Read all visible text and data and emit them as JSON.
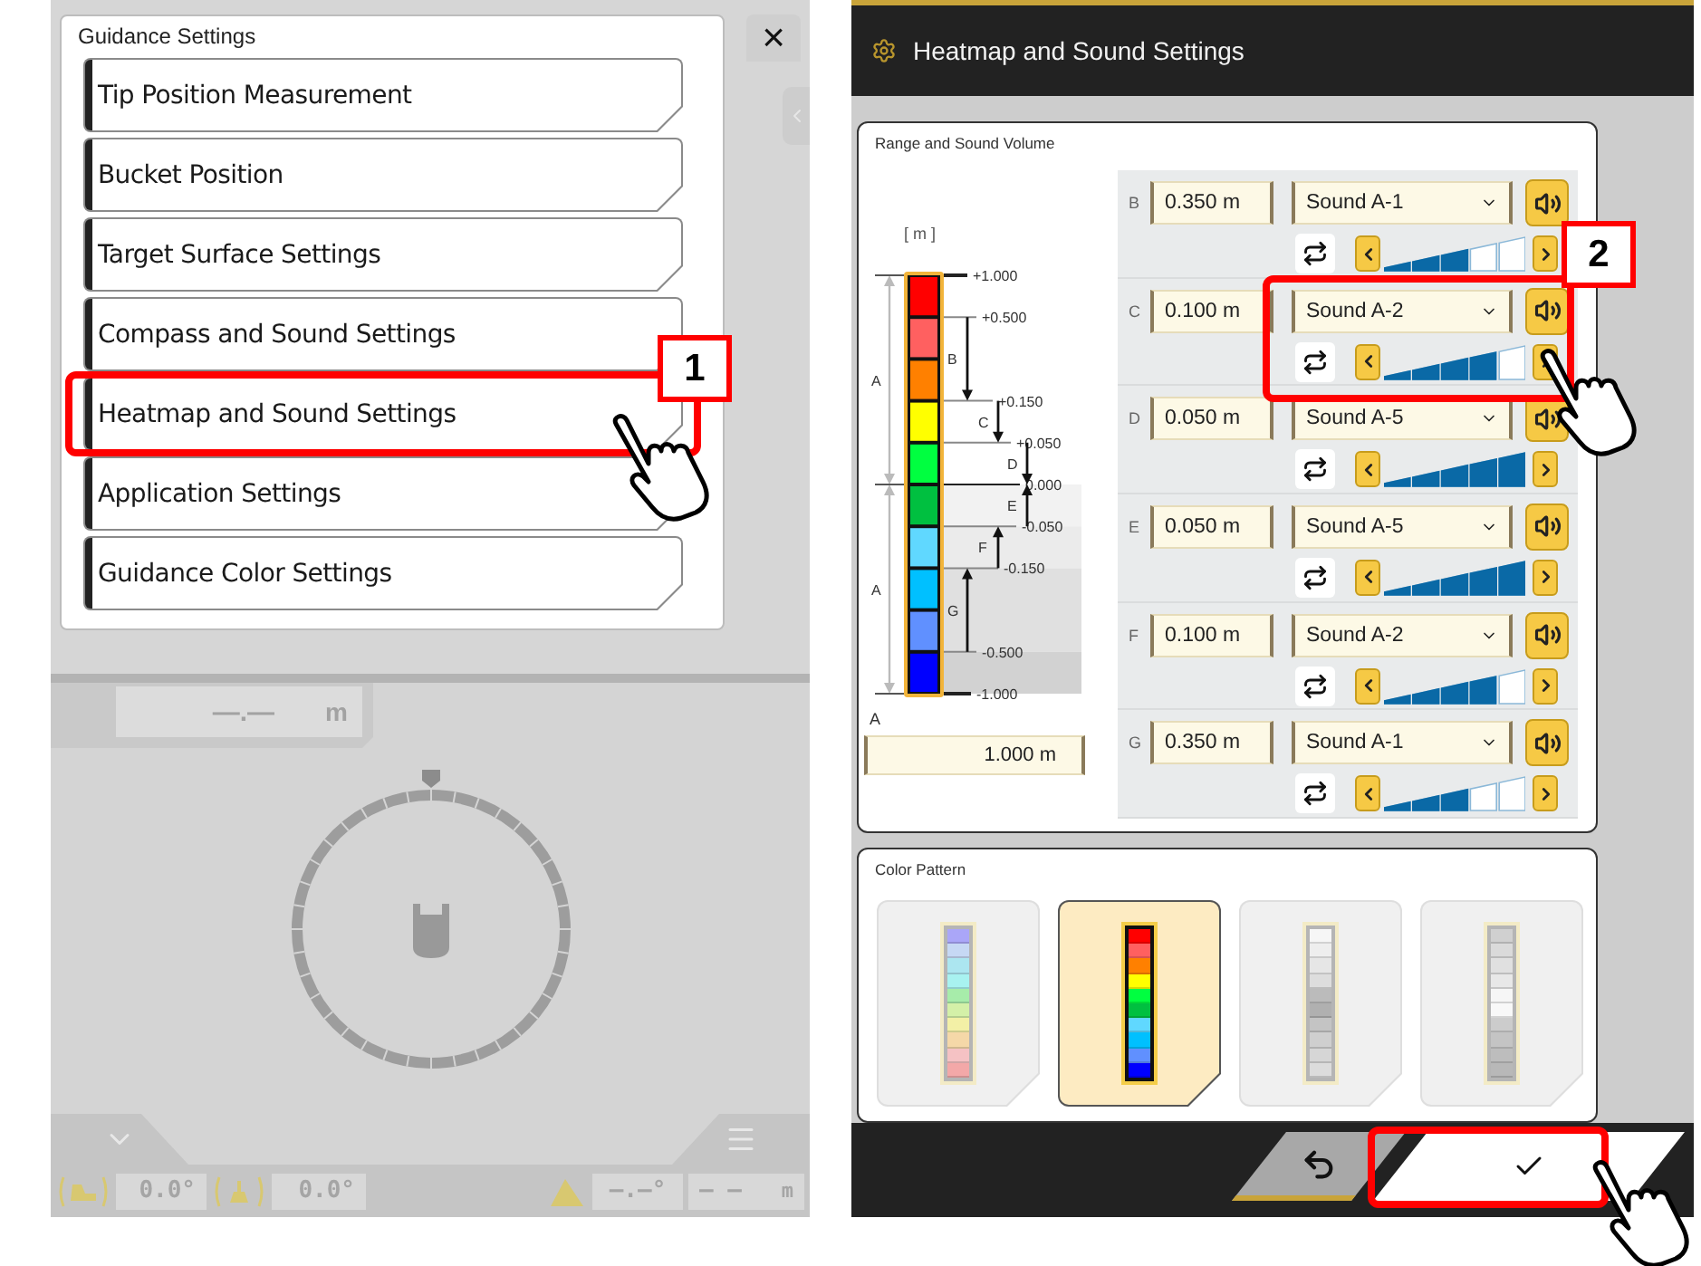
{
  "left_screen": {
    "menu": {
      "title": "Guidance Settings",
      "items": [
        {
          "label": "Tip Position Measurement"
        },
        {
          "label": "Bucket Position"
        },
        {
          "label": "Target Surface Settings"
        },
        {
          "label": "Compass and Sound Settings"
        },
        {
          "label": "Heatmap and Sound Settings"
        },
        {
          "label": "Application Settings"
        },
        {
          "label": "Guidance Color Settings"
        }
      ]
    },
    "close": "×",
    "distance_readout": {
      "value": "—.—",
      "unit": "m"
    },
    "status_bar": {
      "pitch": "0.0°",
      "roll": "0.0°",
      "angle": "—.—°",
      "distance": "— —",
      "unit": "m"
    }
  },
  "right_screen": {
    "title": "Heatmap and Sound Settings",
    "range_panel": {
      "title": "Range and Sound Volume",
      "unit_label": "[ m ]",
      "ticks": [
        "+1.000",
        "+0.500",
        "+0.150",
        "+0.050",
        "0.000",
        "-0.050",
        "-0.150",
        "-0.500",
        "-1.000"
      ],
      "arrows": [
        "B",
        "C",
        "D",
        "E",
        "F",
        "G"
      ],
      "a_labels": [
        "A",
        "A"
      ],
      "a_field": {
        "label": "A",
        "value": "1.000 m"
      },
      "rows": [
        {
          "label": "B",
          "value": "0.350 m",
          "sound": "Sound A-1",
          "level": 0.6
        },
        {
          "label": "C",
          "value": "0.100 m",
          "sound": "Sound A-2",
          "level": 0.8
        },
        {
          "label": "D",
          "value": "0.050 m",
          "sound": "Sound A-5",
          "level": 1
        },
        {
          "label": "E",
          "value": "0.050 m",
          "sound": "Sound A-5",
          "level": 1
        },
        {
          "label": "F",
          "value": "0.100 m",
          "sound": "Sound A-2",
          "level": 0.8
        },
        {
          "label": "G",
          "value": "0.350 m",
          "sound": "Sound A-1",
          "level": 0.6
        }
      ]
    },
    "color_pattern": {
      "title": "Color Pattern",
      "patterns": [
        {
          "selected": false,
          "cells": [
            {
              "color": "#aaa6f8"
            },
            {
              "color": "#c6d8f4"
            },
            {
              "color": "#ace6f0"
            },
            {
              "color": "#a8f2f0"
            },
            {
              "color": "#a7ecaa"
            },
            {
              "color": "#d4f0a8"
            },
            {
              "color": "#f3f0a6"
            },
            {
              "color": "#f5d8a8"
            },
            {
              "color": "#f5c2c4"
            },
            {
              "color": "#f3a8a8"
            }
          ]
        },
        {
          "selected": true,
          "cells": [
            {
              "color": "#ff0000"
            },
            {
              "color": "#ff6060"
            },
            {
              "color": "#ff8000"
            },
            {
              "color": "#ffff00"
            },
            {
              "color": "#00ff40"
            },
            {
              "color": "#00c040"
            },
            {
              "color": "#60d8ff"
            },
            {
              "color": "#00c0ff"
            },
            {
              "color": "#6090ff"
            },
            {
              "color": "#0000ff"
            }
          ]
        },
        {
          "selected": false,
          "cells": [
            {
              "color": "#f6f6f6"
            },
            {
              "color": "#eeeeee"
            },
            {
              "color": "#e6e6e6"
            },
            {
              "color": "#dddddd"
            },
            {
              "color": "#bbbbbb"
            },
            {
              "color": "#b0b0b0"
            },
            {
              "color": "#c4c4c4"
            },
            {
              "color": "#cfcfcf"
            },
            {
              "color": "#d6d6d6"
            },
            {
              "color": "#dcdcdc"
            }
          ]
        },
        {
          "selected": false,
          "cells": [
            {
              "color": "#d0d0d0"
            },
            {
              "color": "#dadada"
            },
            {
              "color": "#e0e0e0"
            },
            {
              "color": "#e8e8e8"
            },
            {
              "color": "#f6f6f6"
            },
            {
              "color": "#f8f8f8"
            },
            {
              "color": "#cccccc"
            },
            {
              "color": "#c4c4c4"
            },
            {
              "color": "#bdbdbd"
            },
            {
              "color": "#b8b8b8"
            }
          ]
        }
      ]
    }
  },
  "callouts": [
    {
      "label": "1"
    },
    {
      "label": "2"
    }
  ]
}
